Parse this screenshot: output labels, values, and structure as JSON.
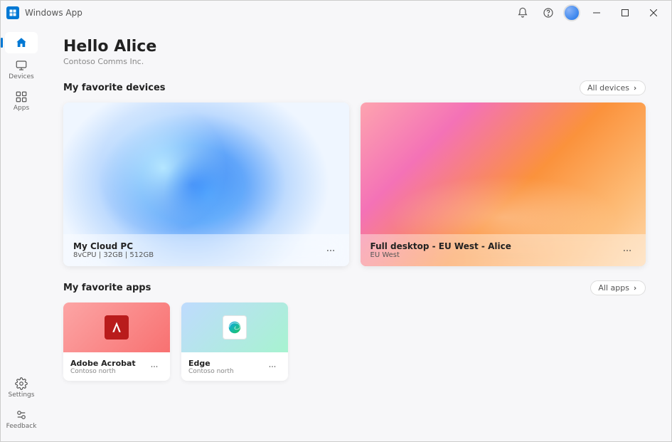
{
  "titlebar": {
    "app_name": "Windows App"
  },
  "sidebar": {
    "home": "Home",
    "devices": "Devices",
    "apps": "Apps",
    "settings": "Settings",
    "feedback": "Feedback"
  },
  "header": {
    "greeting": "Hello Alice",
    "org": "Contoso Comms Inc."
  },
  "devices_section": {
    "title": "My favorite devices",
    "all_link": "All devices",
    "cards": [
      {
        "name": "My Cloud PC",
        "sub": "8vCPU | 32GB | 512GB"
      },
      {
        "name": "Full desktop - EU West - Alice",
        "sub": "EU West"
      }
    ]
  },
  "apps_section": {
    "title": "My favorite apps",
    "all_link": "All apps",
    "cards": [
      {
        "name": "Adobe Acrobat",
        "sub": "Contoso north"
      },
      {
        "name": "Edge",
        "sub": "Contoso north"
      }
    ]
  }
}
